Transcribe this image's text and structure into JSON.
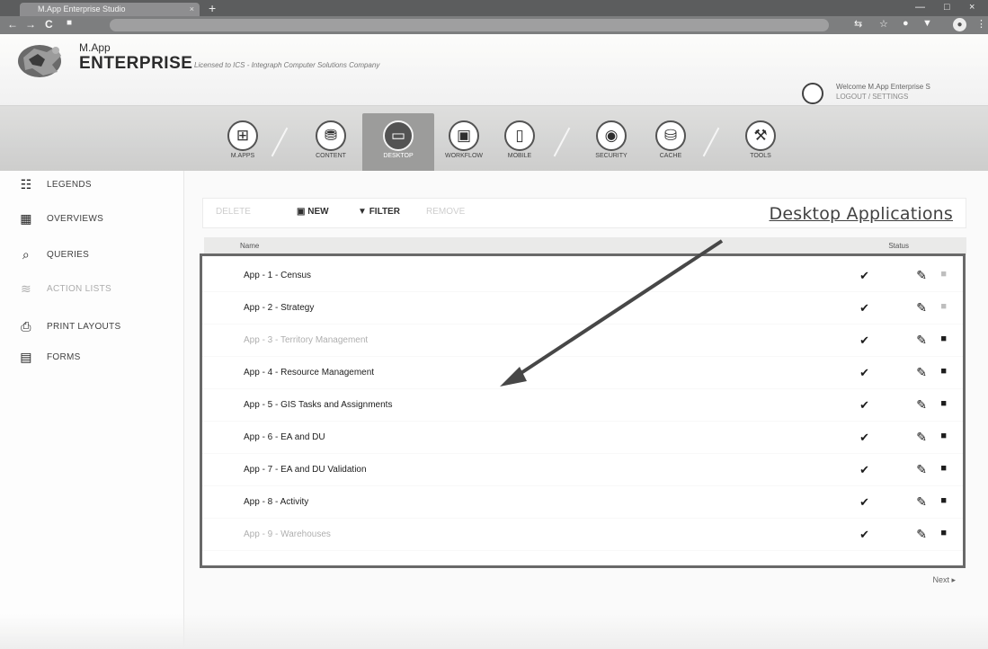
{
  "browser": {
    "tab_title": "M.App Enterprise Studio",
    "tab_close": "×",
    "new_tab": "+",
    "nav_back": "←",
    "nav_forward": "→",
    "nav_reload": "C",
    "win_min": "—",
    "win_max": "□",
    "win_close": "×"
  },
  "header": {
    "logo_line1": "M.App",
    "logo_line2": "ENTERPRISE",
    "subtitle": "Licensed to ICS - Integraph Computer Solutions Company",
    "user_line1": "Welcome M.App Enterprise S",
    "user_line2": "LOGOUT / SETTINGS"
  },
  "modules": [
    {
      "label": "M.APPS",
      "icon": "apps-grid-icon",
      "glyph": "⊞",
      "active": false
    },
    {
      "label": "CONTENT",
      "icon": "content-stack-icon",
      "glyph": "⛃",
      "active": false
    },
    {
      "label": "DESKTOP",
      "icon": "desktop-monitor-icon",
      "glyph": "▭",
      "active": true
    },
    {
      "label": "WORKFLOW",
      "icon": "workflow-icon",
      "glyph": "▣",
      "active": false
    },
    {
      "label": "MOBILE",
      "icon": "mobile-device-icon",
      "glyph": "▯",
      "active": false
    },
    {
      "label": "SECURITY",
      "icon": "security-user-icon",
      "glyph": "◉",
      "active": false
    },
    {
      "label": "CACHE",
      "icon": "cache-drive-icon",
      "glyph": "⛁",
      "active": false
    },
    {
      "label": "TOOLS",
      "icon": "tools-wrench-icon",
      "glyph": "⚒",
      "active": false
    }
  ],
  "sidebar": {
    "items": [
      {
        "label": "LEGENDS",
        "icon": "legends-icon",
        "glyph": "☷",
        "faded": false
      },
      {
        "label": "OVERVIEWS",
        "icon": "overviews-icon",
        "glyph": "▦",
        "faded": false
      },
      {
        "label": "QUERIES",
        "icon": "queries-magnifier-icon",
        "glyph": "⌕",
        "faded": false
      },
      {
        "label": "ACTION LISTS",
        "icon": "action-lists-icon",
        "glyph": "≋",
        "faded": true
      },
      {
        "label": "PRINT LAYOUTS",
        "icon": "print-layouts-icon",
        "glyph": "⎙",
        "faded": false
      },
      {
        "label": "FORMS",
        "icon": "forms-icon",
        "glyph": "▤",
        "faded": false
      }
    ]
  },
  "toolbar": {
    "delete_label": "DELETE",
    "new_label": "NEW",
    "new_glyph": "▣",
    "filter_label": "FILTER",
    "filter_glyph": "▼",
    "remove_label": "REMOVE",
    "section_title": "Desktop Applications"
  },
  "table": {
    "header_name": "Name",
    "header_status": "Status",
    "check_glyph": "✔",
    "edit_glyph": "✎",
    "delete_glyph": "■",
    "rows": [
      {
        "name": "App - 1 - Census",
        "faded": false,
        "delete_faded": true
      },
      {
        "name": "App - 2 - Strategy",
        "faded": false,
        "delete_faded": true
      },
      {
        "name": "App - 3 - Territory Management",
        "faded": true,
        "delete_faded": false
      },
      {
        "name": "App - 4 - Resource Management",
        "faded": false,
        "delete_faded": false
      },
      {
        "name": "App - 5 - GIS Tasks and Assignments",
        "faded": false,
        "delete_faded": false
      },
      {
        "name": "App - 6 - EA and DU",
        "faded": false,
        "delete_faded": false
      },
      {
        "name": "App - 7 - EA and DU Validation",
        "faded": false,
        "delete_faded": false
      },
      {
        "name": "App - 8 - Activity",
        "faded": false,
        "delete_faded": false
      },
      {
        "name": "App - 9 - Warehouses",
        "faded": true,
        "delete_faded": false
      }
    ]
  },
  "pager": {
    "text": "Next ▸"
  }
}
